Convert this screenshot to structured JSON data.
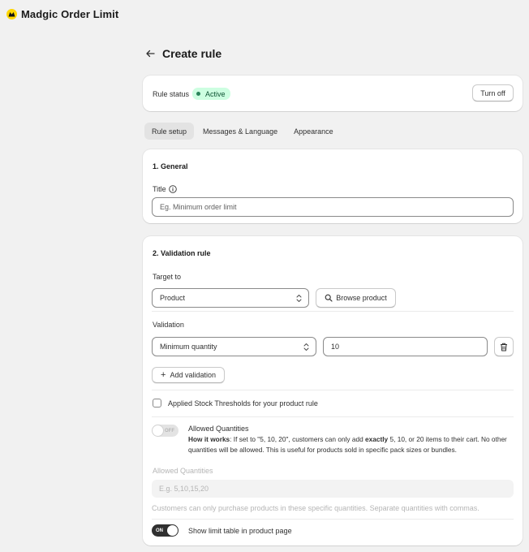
{
  "app": {
    "name": "Madgic Order Limit",
    "logo_color": "#000000",
    "logo_accent": "#ffd600"
  },
  "page": {
    "title": "Create rule",
    "back_icon": "arrow-left-icon"
  },
  "status": {
    "label": "Rule status",
    "badge": "Active",
    "button": "Turn off"
  },
  "tabs": [
    {
      "label": "Rule setup",
      "active": true
    },
    {
      "label": "Messages & Language",
      "active": false
    },
    {
      "label": "Appearance",
      "active": false
    }
  ],
  "general": {
    "heading": "1. General",
    "title_label": "Title",
    "title_placeholder": "Eg. Minimum order limit",
    "title_value": ""
  },
  "validation": {
    "heading": "2. Validation rule",
    "target_label": "Target to",
    "target_value": "Product",
    "browse_button": "Browse product",
    "validation_label": "Validation",
    "validation_type": "Minimum quantity",
    "validation_value": "10",
    "add_validation": "Add validation",
    "stock_thresholds": {
      "label": "Applied Stock Thresholds for your product rule",
      "checked": false
    },
    "allowed_quantities": {
      "toggle_state": "OFF",
      "title": "Allowed Quantities",
      "howto_bold": "How it works",
      "howto_a": ": If set to \"5, 10, 20\", customers can only add ",
      "howto_bold2": "exactly",
      "howto_b": " 5, 10, or 20 items to their cart. No other quantities will be allowed. This is useful for products sold in specific pack sizes or bundles.",
      "field_label": "Allowed Quantities",
      "field_placeholder": "E.g. 5,10,15,20",
      "help_text": "Customers can only purchase products in these specific quantities. Separate quantities with commas."
    },
    "limit_table": {
      "toggle_state": "ON",
      "label": "Show limit table in product page"
    }
  },
  "colors": {
    "background": "#f1f1f1",
    "card": "#ffffff",
    "badge_bg": "#cdfee1",
    "badge_dot": "#29845a",
    "toggle_on": "#303030"
  }
}
